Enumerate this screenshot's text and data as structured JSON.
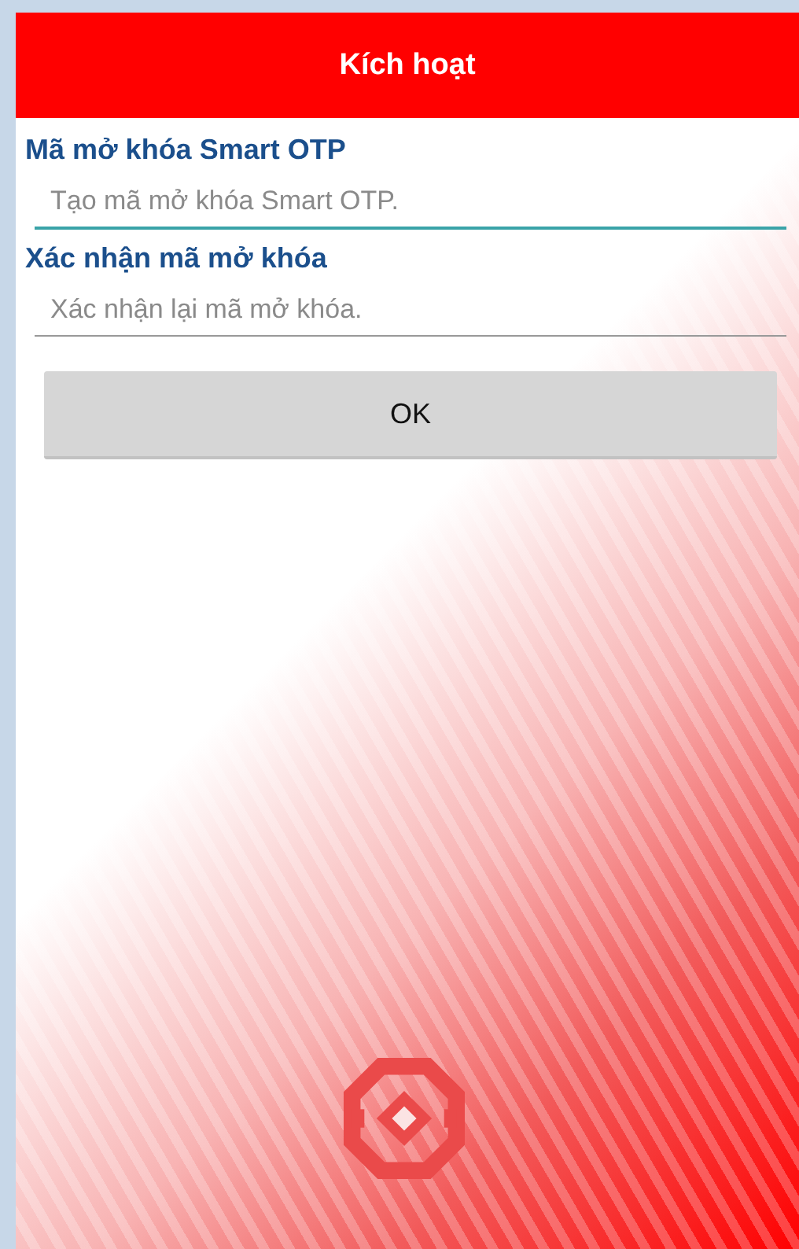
{
  "header": {
    "title": "Kích hoạt"
  },
  "fields": [
    {
      "label": "Mã mở khóa Smart OTP",
      "placeholder": "Tạo mã mở khóa Smart OTP.",
      "focused": true
    },
    {
      "label": "Xác nhận mã mở khóa",
      "placeholder": "Xác nhận lại mã mở khóa.",
      "focused": false
    }
  ],
  "buttons": [
    "OK"
  ]
}
